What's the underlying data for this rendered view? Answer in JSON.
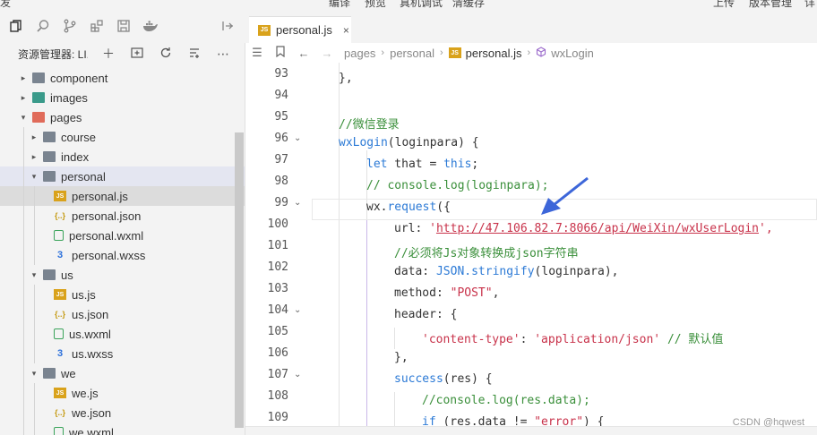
{
  "menubar": [
    "发",
    "编译",
    "预览",
    "真机调试",
    "清缓存",
    "上传",
    "版本管理",
    "详"
  ],
  "activity_icons": [
    "files-icon",
    "search-icon",
    "source-control-icon",
    "extensions-icon",
    "save-icon",
    "docker-icon",
    "split-icon"
  ],
  "sidebar": {
    "title": "资源管理器: LI...",
    "actions": [
      "new-file-icon",
      "new-folder-icon",
      "refresh-icon",
      "collapse-icon",
      "more-icon"
    ],
    "tree": [
      {
        "label": "component",
        "type": "folder",
        "level": 0,
        "expanded": false
      },
      {
        "label": "images",
        "type": "folder-img",
        "level": 0,
        "expanded": false
      },
      {
        "label": "pages",
        "type": "folder-pg",
        "level": 0,
        "expanded": true
      },
      {
        "label": "course",
        "type": "folder",
        "level": 1,
        "expanded": false
      },
      {
        "label": "index",
        "type": "folder",
        "level": 1,
        "expanded": false
      },
      {
        "label": "personal",
        "type": "folder",
        "level": 1,
        "expanded": true,
        "highlight": true
      },
      {
        "label": "personal.js",
        "type": "js",
        "level": 2,
        "selected": true
      },
      {
        "label": "personal.json",
        "type": "json",
        "level": 2
      },
      {
        "label": "personal.wxml",
        "type": "wxml",
        "level": 2
      },
      {
        "label": "personal.wxss",
        "type": "wxss",
        "level": 2
      },
      {
        "label": "us",
        "type": "folder",
        "level": 1,
        "expanded": true
      },
      {
        "label": "us.js",
        "type": "js",
        "level": 2
      },
      {
        "label": "us.json",
        "type": "json",
        "level": 2
      },
      {
        "label": "us.wxml",
        "type": "wxml",
        "level": 2
      },
      {
        "label": "us.wxss",
        "type": "wxss",
        "level": 2
      },
      {
        "label": "we",
        "type": "folder",
        "level": 1,
        "expanded": true
      },
      {
        "label": "we.js",
        "type": "js",
        "level": 2
      },
      {
        "label": "we.json",
        "type": "json",
        "level": 2
      },
      {
        "label": "we.wxml",
        "type": "wxml",
        "level": 2
      }
    ]
  },
  "tab": {
    "label": "personal.js",
    "close": "×"
  },
  "breadcrumb": {
    "parts": [
      "pages",
      "personal",
      "personal.js",
      "wxLogin"
    ]
  },
  "editor": {
    "lines": [
      {
        "n": "93",
        "fold": false
      },
      {
        "n": "94",
        "fold": false
      },
      {
        "n": "95",
        "fold": false
      },
      {
        "n": "96",
        "fold": true
      },
      {
        "n": "97",
        "fold": false
      },
      {
        "n": "98",
        "fold": false
      },
      {
        "n": "99",
        "fold": true
      },
      {
        "n": "100",
        "fold": false
      },
      {
        "n": "101",
        "fold": false
      },
      {
        "n": "102",
        "fold": false
      },
      {
        "n": "103",
        "fold": false
      },
      {
        "n": "104",
        "fold": true
      },
      {
        "n": "105",
        "fold": false
      },
      {
        "n": "106",
        "fold": false
      },
      {
        "n": "107",
        "fold": true
      },
      {
        "n": "108",
        "fold": false
      },
      {
        "n": "109",
        "fold": false
      }
    ],
    "code": {
      "l93": "},",
      "l95": "//微信登录",
      "l96_fn": "wxLogin",
      "l96_rest": "(loginpara) {",
      "l97_kw": "let",
      "l97_mid": " that = ",
      "l97_kw2": "this",
      "l97_end": ";",
      "l98": "// console.log(loginpara);",
      "l99_obj": "wx.",
      "l99_fn": "request",
      "l99_end": "({",
      "l100_key": "url: ",
      "l100_q1": "'",
      "l100_url": "http://47.106.82.7:8066/api/WeiXin/wxUserLogin",
      "l100_q2": "',",
      "l101": "//必须将Js对象转换成json字符串",
      "l102_key": "data: ",
      "l102_fn": "JSON.stringify",
      "l102_end": "(loginpara),",
      "l103_key": "method: ",
      "l103_str": "\"POST\"",
      "l103_end": ",",
      "l104": "header: {",
      "l105_k": "'content-type'",
      "l105_colon": ": ",
      "l105_v": "'application/json'",
      "l105_cm": " // 默认值",
      "l106": "},",
      "l107_fn": "success",
      "l107_rest": "(res) {",
      "l108": "//console.log(res.data);",
      "l109_kw": "if",
      "l109_mid": " (res.data != ",
      "l109_str": "\"error\"",
      "l109_end": ") {"
    }
  },
  "watermark": "CSDN @hqwest",
  "colors": {
    "keyword": "#2c7ad6",
    "string": "#c8324a",
    "comment": "#3a8f3a",
    "arrow": "#3d66d9"
  }
}
